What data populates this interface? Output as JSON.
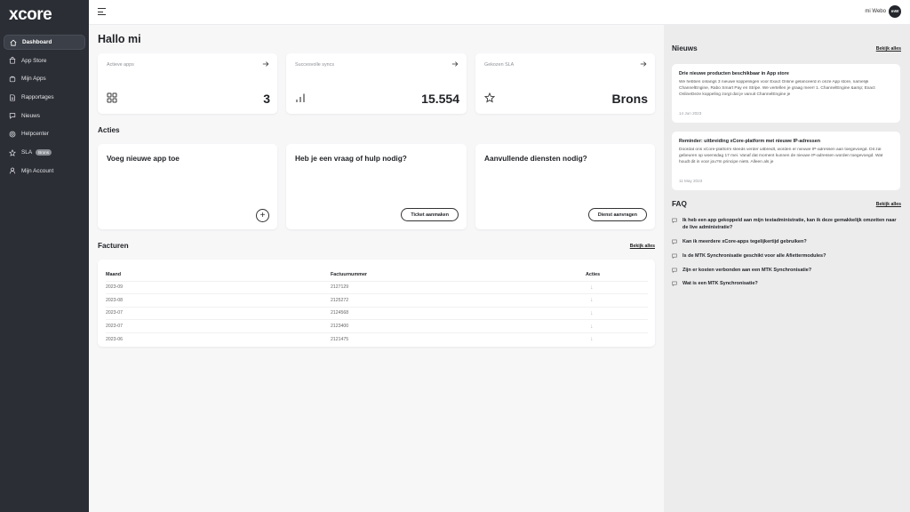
{
  "app": {
    "logo": "xcore"
  },
  "sidebar": {
    "items": [
      {
        "label": "Dashboard",
        "icon": "home-icon"
      },
      {
        "label": "App Store",
        "icon": "store-icon"
      },
      {
        "label": "Mijn Apps",
        "icon": "apps-icon"
      },
      {
        "label": "Rapportages",
        "icon": "report-icon"
      },
      {
        "label": "Nieuws",
        "icon": "news-icon"
      },
      {
        "label": "Helpcenter",
        "icon": "help-icon"
      },
      {
        "label": "SLA",
        "icon": "star-icon",
        "badge": "Brons"
      },
      {
        "label": "Mijn Account",
        "icon": "user-icon"
      }
    ]
  },
  "topbar": {
    "user_name": "mi Webo",
    "avatar_initials": "mW"
  },
  "main": {
    "title": "Hallo mi",
    "stats": [
      {
        "label": "Actieve apps",
        "value": "3"
      },
      {
        "label": "Succesvolle syncs",
        "value": "15.554"
      },
      {
        "label": "Gekozen SLA",
        "value": "Brons"
      }
    ],
    "actions_title": "Acties",
    "actions": [
      {
        "title": "Voeg nieuwe app toe"
      },
      {
        "title": "Heb je een vraag of hulp nodig?",
        "button": "Ticket aanmaken"
      },
      {
        "title": "Aanvullende diensten nodig?",
        "button": "Dienst aanvragen"
      }
    ],
    "invoices": {
      "title": "Facturen",
      "view_all": "Bekijk alles",
      "headers": [
        "Maand",
        "Factuurnummer",
        "Acties"
      ],
      "rows": [
        [
          "2023-09",
          "2127129"
        ],
        [
          "2023-08",
          "2125272"
        ],
        [
          "2023-07",
          "2124568"
        ],
        [
          "2023-07",
          "2123400"
        ],
        [
          "2023-06",
          "2121475"
        ]
      ]
    }
  },
  "news": {
    "title": "Nieuws",
    "view_all": "Bekijk alles",
    "items": [
      {
        "title": "Drie nieuwe producten beschikbaar in App store",
        "body": "We hebben onlangs 3 nieuwe koppelingen voor Exact Online gelanceerd in onze App store, namelijk ChannelEngine, Rabo Smart Pay en Stripe. We vertellen je graag meer! 1. ChannelEngine &amp; Exact OnlineDeze koppeling zorgt dat je vanuit ChannelEngine je",
        "date": "14 Jun 2023"
      },
      {
        "title": "Reminder: uitbreiding xCore-platform met nieuwe IP-adressen",
        "body": "Doordat ons xCore-platform steeds verder uitbreidt, worden er nieuwe IP-adressen aan toegevoegd. Dit zal gebeuren op woensdag 17 mei. Vanaf dat moment kunnen de nieuwe IP-adressen worden toegevoegd. Wat houdt dit in voor jou?In principe niets. Alleen als je",
        "date": "11 May 2023"
      }
    ]
  },
  "faq": {
    "title": "FAQ",
    "view_all": "Bekijk alles",
    "items": [
      "Ik heb een app gekoppeld aan mijn testadministratie, kan ik deze gemakkelijk omzetten naar de live administratie?",
      "Kan ik meerdere xCore-apps tegelijkertijd gebruiken?",
      "Is de MTK Synchronisatie geschikt voor alle Afiettermodules?",
      "Zijn er kosten verbonden aan een MTK Synchronisatie?",
      "Wat is een MTK Synchronisatie?"
    ]
  }
}
